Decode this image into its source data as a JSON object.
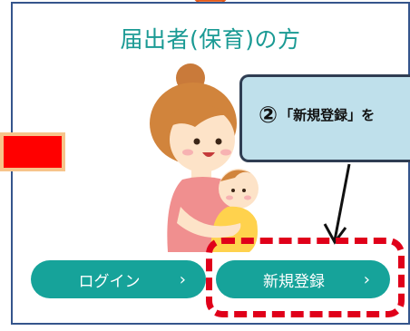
{
  "page": {
    "title": "届出者(保育)の方"
  },
  "buttons": {
    "login_label": "ログイン",
    "register_label": "新規登録",
    "chevron": "›"
  },
  "callout": {
    "number": "②",
    "quoted_text": "「新規登録」を"
  },
  "colors": {
    "accent": "#16a39a",
    "title": "#1a9a94",
    "border": "#35558c",
    "highlight_red": "#e0001a",
    "callout_bg": "#bfe0eb",
    "arrow_orange": "#f4793a"
  }
}
